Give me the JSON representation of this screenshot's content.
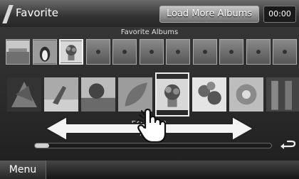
{
  "header": {
    "title": "Favorite",
    "load_more_button": "Load More Albums",
    "clock": "00:00"
  },
  "favorites_label": "Favorite Albums",
  "top_thumbnails": [
    {
      "kind": "image",
      "icon": "lake-scene-icon"
    },
    {
      "kind": "image",
      "icon": "penguin-icon"
    },
    {
      "kind": "image",
      "icon": "flower-bouquet-icon",
      "selected": true
    },
    {
      "kind": "empty"
    },
    {
      "kind": "empty"
    },
    {
      "kind": "empty"
    },
    {
      "kind": "empty"
    },
    {
      "kind": "empty"
    },
    {
      "kind": "empty"
    },
    {
      "kind": "empty"
    },
    {
      "kind": "empty"
    }
  ],
  "albums": [
    {
      "icon": "autumn-leaves-icon"
    },
    {
      "icon": "beach-chair-icon"
    },
    {
      "icon": "coastal-tree-icon"
    },
    {
      "icon": "leaf-icon"
    },
    {
      "icon": "flower-bouquet-icon",
      "selected": true
    },
    {
      "icon": "flower-icon"
    },
    {
      "icon": "flower-pattern-icon"
    },
    {
      "icon": "wooden-frame-icon"
    }
  ],
  "now_playing": {
    "album": "FO....ER",
    "artist": "A....D"
  },
  "progress": 0.06,
  "footer": {
    "menu_label": "Menu"
  }
}
